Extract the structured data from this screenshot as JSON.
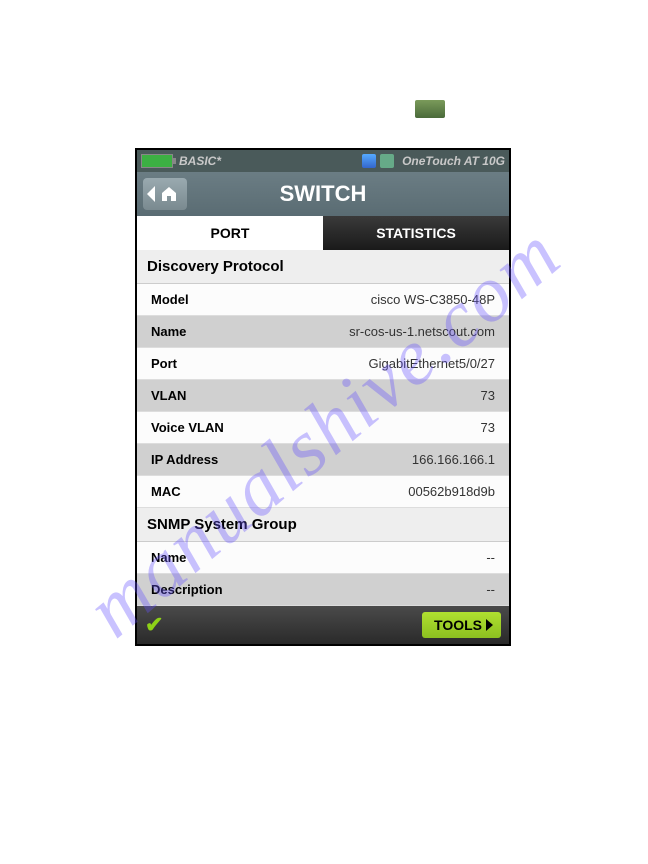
{
  "watermark": "manualshive.com",
  "status": {
    "profile": "BASIC*",
    "device": "OneTouch AT 10G"
  },
  "title": "SWITCH",
  "tabs": {
    "port": "PORT",
    "statistics": "STATISTICS"
  },
  "sections": {
    "discovery": {
      "header": "Discovery Protocol",
      "rows": [
        {
          "label": "Model",
          "value": "cisco WS-C3850-48P"
        },
        {
          "label": "Name",
          "value": "sr-cos-us-1.netscout.com"
        },
        {
          "label": "Port",
          "value": "GigabitEthernet5/0/27"
        },
        {
          "label": "VLAN",
          "value": "73"
        },
        {
          "label": "Voice VLAN",
          "value": "73"
        },
        {
          "label": "IP Address",
          "value": "166.166.166.1"
        },
        {
          "label": "MAC",
          "value": "00562b918d9b"
        }
      ]
    },
    "snmp": {
      "header": "SNMP System Group",
      "rows": [
        {
          "label": "Name",
          "value": "--"
        },
        {
          "label": "Description",
          "value": "--"
        }
      ]
    }
  },
  "footer": {
    "tools": "TOOLS"
  }
}
